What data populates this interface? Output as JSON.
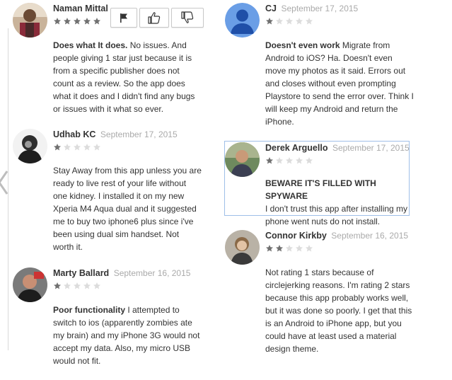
{
  "reviews": [
    {
      "author": "Naman Mittal",
      "date": "",
      "rating": 5,
      "title": "Does what It does.",
      "text": " No issues. And people giving 1 star just because it is from a specific publisher does not count as a review. So the app does what it does and I didn't find any bugs or issues with it what so ever."
    },
    {
      "author": "CJ",
      "date": "September 17, 2015",
      "rating": 1,
      "title": "Doesn't even work",
      "text": " Migrate from Android to iOS? Ha. Doesn't even move my photos as it said. Errors out and closes without even prompting Playstore to send the error over. Think I will keep my Android and return the iPhone."
    },
    {
      "author": "Udhab KC",
      "date": "September 17, 2015",
      "rating": 1,
      "title": "",
      "text": "Stay Away from this app unless you are ready to live rest of your life without one kidney. I installed it on my new Xperia M4 Aqua dual and it suggested me to buy two iphone6 plus since i've been using dual sim handset. Not worth it."
    },
    {
      "author": "Derek Arguello",
      "date": "September 17, 2015",
      "rating": 1,
      "title": "BEWARE IT'S FILLED WITH SPYWARE",
      "text": "I don't trust this app after installing my phone went nuts do not install."
    },
    {
      "author": "Connor Kirkby",
      "date": "September 16, 2015",
      "rating": 2,
      "title": "",
      "text": "Not rating 1 stars because of circlejerking reasons. I'm rating 2 stars because this app probably works well, but it was done so poorly. I get that this is an Android to iPhone app, but you could have at least used a material design theme."
    },
    {
      "author": "Marty Ballard",
      "date": "September 16, 2015",
      "rating": 1,
      "title": "Poor functionality",
      "text": " I attempted to switch to ios (apparently zombies ate my brain) and my iPhone 3G would not accept my data. Also, my micro USB would not fit."
    }
  ],
  "actions": {
    "flag_icon": "flag-icon",
    "thumbs_up_icon": "thumbs-up-icon",
    "thumbs_down_icon": "thumbs-down-icon"
  },
  "colors": {
    "star_on": "#707070",
    "star_off": "#dcdcdc",
    "highlight_border": "#9fbfe8",
    "date": "#aaaaaa"
  }
}
